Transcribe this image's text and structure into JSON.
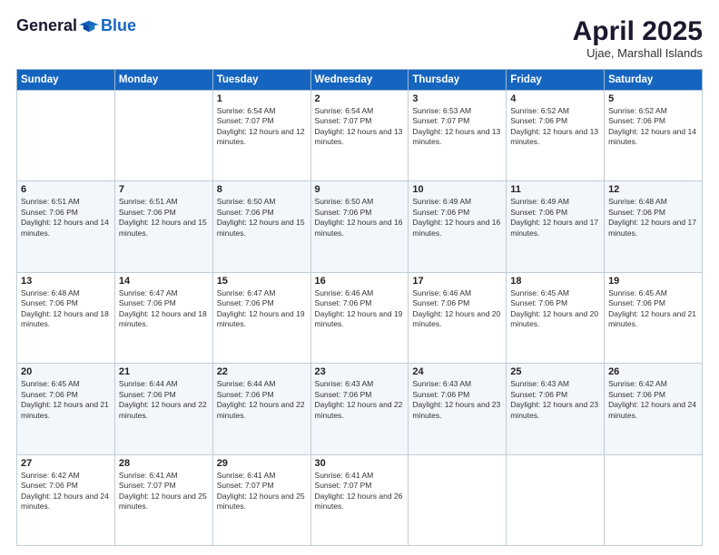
{
  "logo": {
    "general": "General",
    "blue": "Blue"
  },
  "title": "April 2025",
  "location": "Ujae, Marshall Islands",
  "days_of_week": [
    "Sunday",
    "Monday",
    "Tuesday",
    "Wednesday",
    "Thursday",
    "Friday",
    "Saturday"
  ],
  "weeks": [
    [
      {
        "day": "",
        "info": ""
      },
      {
        "day": "",
        "info": ""
      },
      {
        "day": "1",
        "info": "Sunrise: 6:54 AM\nSunset: 7:07 PM\nDaylight: 12 hours and 12 minutes."
      },
      {
        "day": "2",
        "info": "Sunrise: 6:54 AM\nSunset: 7:07 PM\nDaylight: 12 hours and 13 minutes."
      },
      {
        "day": "3",
        "info": "Sunrise: 6:53 AM\nSunset: 7:07 PM\nDaylight: 12 hours and 13 minutes."
      },
      {
        "day": "4",
        "info": "Sunrise: 6:52 AM\nSunset: 7:06 PM\nDaylight: 12 hours and 13 minutes."
      },
      {
        "day": "5",
        "info": "Sunrise: 6:52 AM\nSunset: 7:06 PM\nDaylight: 12 hours and 14 minutes."
      }
    ],
    [
      {
        "day": "6",
        "info": "Sunrise: 6:51 AM\nSunset: 7:06 PM\nDaylight: 12 hours and 14 minutes."
      },
      {
        "day": "7",
        "info": "Sunrise: 6:51 AM\nSunset: 7:06 PM\nDaylight: 12 hours and 15 minutes."
      },
      {
        "day": "8",
        "info": "Sunrise: 6:50 AM\nSunset: 7:06 PM\nDaylight: 12 hours and 15 minutes."
      },
      {
        "day": "9",
        "info": "Sunrise: 6:50 AM\nSunset: 7:06 PM\nDaylight: 12 hours and 16 minutes."
      },
      {
        "day": "10",
        "info": "Sunrise: 6:49 AM\nSunset: 7:06 PM\nDaylight: 12 hours and 16 minutes."
      },
      {
        "day": "11",
        "info": "Sunrise: 6:49 AM\nSunset: 7:06 PM\nDaylight: 12 hours and 17 minutes."
      },
      {
        "day": "12",
        "info": "Sunrise: 6:48 AM\nSunset: 7:06 PM\nDaylight: 12 hours and 17 minutes."
      }
    ],
    [
      {
        "day": "13",
        "info": "Sunrise: 6:48 AM\nSunset: 7:06 PM\nDaylight: 12 hours and 18 minutes."
      },
      {
        "day": "14",
        "info": "Sunrise: 6:47 AM\nSunset: 7:06 PM\nDaylight: 12 hours and 18 minutes."
      },
      {
        "day": "15",
        "info": "Sunrise: 6:47 AM\nSunset: 7:06 PM\nDaylight: 12 hours and 19 minutes."
      },
      {
        "day": "16",
        "info": "Sunrise: 6:46 AM\nSunset: 7:06 PM\nDaylight: 12 hours and 19 minutes."
      },
      {
        "day": "17",
        "info": "Sunrise: 6:46 AM\nSunset: 7:06 PM\nDaylight: 12 hours and 20 minutes."
      },
      {
        "day": "18",
        "info": "Sunrise: 6:45 AM\nSunset: 7:06 PM\nDaylight: 12 hours and 20 minutes."
      },
      {
        "day": "19",
        "info": "Sunrise: 6:45 AM\nSunset: 7:06 PM\nDaylight: 12 hours and 21 minutes."
      }
    ],
    [
      {
        "day": "20",
        "info": "Sunrise: 6:45 AM\nSunset: 7:06 PM\nDaylight: 12 hours and 21 minutes."
      },
      {
        "day": "21",
        "info": "Sunrise: 6:44 AM\nSunset: 7:06 PM\nDaylight: 12 hours and 22 minutes."
      },
      {
        "day": "22",
        "info": "Sunrise: 6:44 AM\nSunset: 7:06 PM\nDaylight: 12 hours and 22 minutes."
      },
      {
        "day": "23",
        "info": "Sunrise: 6:43 AM\nSunset: 7:06 PM\nDaylight: 12 hours and 22 minutes."
      },
      {
        "day": "24",
        "info": "Sunrise: 6:43 AM\nSunset: 7:06 PM\nDaylight: 12 hours and 23 minutes."
      },
      {
        "day": "25",
        "info": "Sunrise: 6:43 AM\nSunset: 7:06 PM\nDaylight: 12 hours and 23 minutes."
      },
      {
        "day": "26",
        "info": "Sunrise: 6:42 AM\nSunset: 7:06 PM\nDaylight: 12 hours and 24 minutes."
      }
    ],
    [
      {
        "day": "27",
        "info": "Sunrise: 6:42 AM\nSunset: 7:06 PM\nDaylight: 12 hours and 24 minutes."
      },
      {
        "day": "28",
        "info": "Sunrise: 6:41 AM\nSunset: 7:07 PM\nDaylight: 12 hours and 25 minutes."
      },
      {
        "day": "29",
        "info": "Sunrise: 6:41 AM\nSunset: 7:07 PM\nDaylight: 12 hours and 25 minutes."
      },
      {
        "day": "30",
        "info": "Sunrise: 6:41 AM\nSunset: 7:07 PM\nDaylight: 12 hours and 26 minutes."
      },
      {
        "day": "",
        "info": ""
      },
      {
        "day": "",
        "info": ""
      },
      {
        "day": "",
        "info": ""
      }
    ]
  ]
}
